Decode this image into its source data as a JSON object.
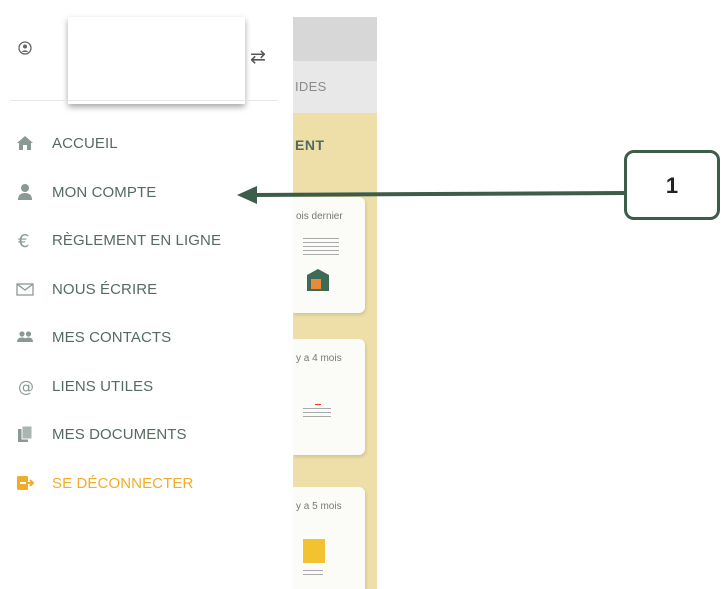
{
  "background": {
    "tab_text": "IDES",
    "section_title": "ENT",
    "cards": [
      {
        "date_text": "ois dernier"
      },
      {
        "date_text": "y a 4 mois"
      },
      {
        "date_text": "y a 5 mois"
      }
    ]
  },
  "drawer": {
    "user_icon": "user-circle-icon",
    "swap_icon": "swap-arrows-icon",
    "menu": [
      {
        "label": "ACCUEIL",
        "icon": "home-icon"
      },
      {
        "label": "MON COMPTE",
        "icon": "person-icon"
      },
      {
        "label": "RÈGLEMENT EN LIGNE",
        "icon": "euro-icon"
      },
      {
        "label": "NOUS ÉCRIRE",
        "icon": "envelope-icon"
      },
      {
        "label": "MES CONTACTS",
        "icon": "contacts-icon"
      },
      {
        "label": "LIENS UTILES",
        "icon": "at-icon"
      },
      {
        "label": "MES DOCUMENTS",
        "icon": "documents-icon"
      },
      {
        "label": "SE DÉCONNECTER",
        "icon": "logout-icon"
      }
    ]
  },
  "annotation": {
    "number": "1"
  },
  "colors": {
    "menu_text": "#566b5f",
    "logout": "#f0ad2a",
    "background_app": "#eedfa8",
    "callout_border": "#3d5c4a"
  }
}
